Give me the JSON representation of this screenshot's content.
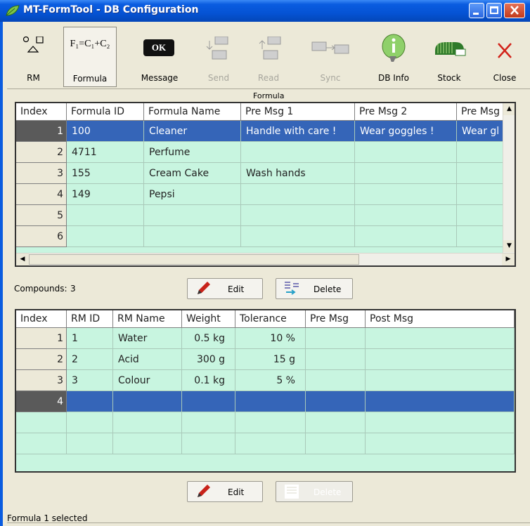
{
  "window": {
    "title": "MT-FormTool - DB Configuration"
  },
  "toolbar": {
    "items": [
      {
        "label": "RM",
        "icon": "shapes-icon",
        "enabled": true
      },
      {
        "label": "Formula",
        "icon": "formula-icon",
        "icon_text": "F₁=C₁+C₂",
        "enabled": true,
        "selected": true
      },
      {
        "label": "Message",
        "icon": "ok-message-icon",
        "icon_text": "OK",
        "enabled": true
      },
      {
        "label": "Send",
        "icon": "send-icon",
        "enabled": false
      },
      {
        "label": "Read",
        "icon": "read-icon",
        "enabled": false
      },
      {
        "label": "Sync",
        "icon": "sync-icon",
        "enabled": false
      },
      {
        "label": "DB Info",
        "icon": "info-icon",
        "enabled": true
      },
      {
        "label": "Stock",
        "icon": "stock-icon",
        "enabled": true
      },
      {
        "label": "Close",
        "icon": "close-x-icon",
        "enabled": true
      }
    ]
  },
  "formula_section": {
    "caption": "Formula",
    "columns": [
      "Index",
      "Formula ID",
      "Formula Name",
      "Pre Msg 1",
      "Pre Msg 2",
      "Pre Msg"
    ],
    "rows": [
      {
        "index": "1",
        "formula_id": "100",
        "formula_name": "Cleaner",
        "pre_msg_1": "Handle with care !",
        "pre_msg_2": "Wear goggles !",
        "pre_msg_3": "Wear gl",
        "selected": true
      },
      {
        "index": "2",
        "formula_id": "4711",
        "formula_name": "Perfume",
        "pre_msg_1": "",
        "pre_msg_2": "",
        "pre_msg_3": ""
      },
      {
        "index": "3",
        "formula_id": "155",
        "formula_name": "Cream Cake",
        "pre_msg_1": "Wash hands",
        "pre_msg_2": "",
        "pre_msg_3": ""
      },
      {
        "index": "4",
        "formula_id": "149",
        "formula_name": "Pepsi",
        "pre_msg_1": "",
        "pre_msg_2": "",
        "pre_msg_3": ""
      },
      {
        "index": "5",
        "formula_id": "",
        "formula_name": "",
        "pre_msg_1": "",
        "pre_msg_2": "",
        "pre_msg_3": ""
      },
      {
        "index": "6",
        "formula_id": "",
        "formula_name": "",
        "pre_msg_1": "",
        "pre_msg_2": "",
        "pre_msg_3": ""
      }
    ],
    "edit_label": "Edit",
    "delete_label": "Delete"
  },
  "compounds": {
    "label": "Compounds:",
    "count": "3"
  },
  "rm_section": {
    "columns": [
      "Index",
      "RM ID",
      "RM Name",
      "Weight",
      "Tolerance",
      "Pre Msg",
      "Post Msg"
    ],
    "rows": [
      {
        "index": "1",
        "rm_id": "1",
        "rm_name": "Water",
        "weight": "0.5 kg",
        "tolerance": "10 %",
        "pre_msg": "",
        "post_msg": ""
      },
      {
        "index": "2",
        "rm_id": "2",
        "rm_name": "Acid",
        "weight": "300 g",
        "tolerance": "15 g",
        "pre_msg": "",
        "post_msg": ""
      },
      {
        "index": "3",
        "rm_id": "3",
        "rm_name": "Colour",
        "weight": "0.1 kg",
        "tolerance": "5 %",
        "pre_msg": "",
        "post_msg": ""
      },
      {
        "index": "4",
        "rm_id": "",
        "rm_name": "",
        "weight": "",
        "tolerance": "",
        "pre_msg": "",
        "post_msg": "",
        "selected": true
      }
    ],
    "edit_label": "Edit",
    "delete_label": "Delete",
    "delete_enabled": false
  },
  "status": {
    "text": "Formula 1 selected"
  },
  "colors": {
    "grid_background": "#c8f5e0",
    "selection": "#3565b8",
    "title_bar": "#0553d4"
  }
}
